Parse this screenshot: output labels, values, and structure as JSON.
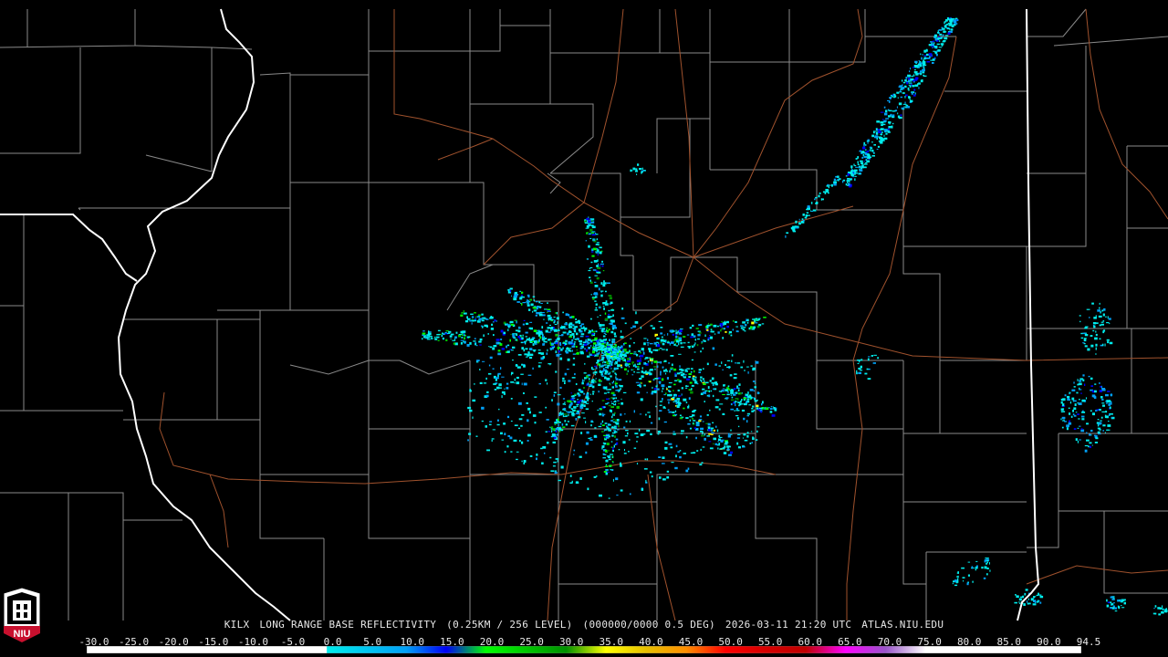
{
  "product": {
    "station": "KILX",
    "title": "LONG RANGE BASE REFLECTIVITY",
    "resolution": "(0.25KM / 256 LEVEL)",
    "volume": "(000000/0000 0.5 DEG)",
    "datetime": "2026-03-11 21:20 UTC",
    "site": "ATLAS.NIU.EDU"
  },
  "logo": {
    "text": "NIU",
    "name": "niu-logo",
    "color": "#c8102e"
  },
  "colors": {
    "background": "#000000",
    "county_lines": "#8a8a8a",
    "state_lines": "#ffffff",
    "roads": "#a0522d"
  },
  "color_scale": {
    "labels": [
      "-30.0",
      "-25.0",
      "-20.0",
      "-15.0",
      "-10.0",
      "-5.0",
      "0.0",
      "5.0",
      "10.0",
      "15.0",
      "20.0",
      "25.0",
      "30.0",
      "35.0",
      "40.0",
      "45.0",
      "50.0",
      "55.0",
      "60.0",
      "65.0",
      "70.0",
      "75.0",
      "80.0",
      "85.0",
      "90.0",
      "94.5"
    ],
    "stops": [
      {
        "dbz": -30,
        "color": "#ffffff"
      },
      {
        "dbz": 0,
        "color": "#ffffff"
      },
      {
        "dbz": 0.1,
        "color": "#00ecec"
      },
      {
        "dbz": 10,
        "color": "#01a0f6"
      },
      {
        "dbz": 15,
        "color": "#0000f6"
      },
      {
        "dbz": 20,
        "color": "#00ff00"
      },
      {
        "dbz": 25,
        "color": "#00c800"
      },
      {
        "dbz": 30,
        "color": "#009000"
      },
      {
        "dbz": 35,
        "color": "#ffff00"
      },
      {
        "dbz": 40,
        "color": "#e7c000"
      },
      {
        "dbz": 45,
        "color": "#ff9000"
      },
      {
        "dbz": 50,
        "color": "#ff0000"
      },
      {
        "dbz": 55,
        "color": "#d60000"
      },
      {
        "dbz": 60,
        "color": "#c00000"
      },
      {
        "dbz": 65,
        "color": "#ff00ff"
      },
      {
        "dbz": 70,
        "color": "#9955c9"
      },
      {
        "dbz": 75,
        "color": "#ffffff"
      },
      {
        "dbz": 94.5,
        "color": "#ffffff"
      }
    ]
  }
}
